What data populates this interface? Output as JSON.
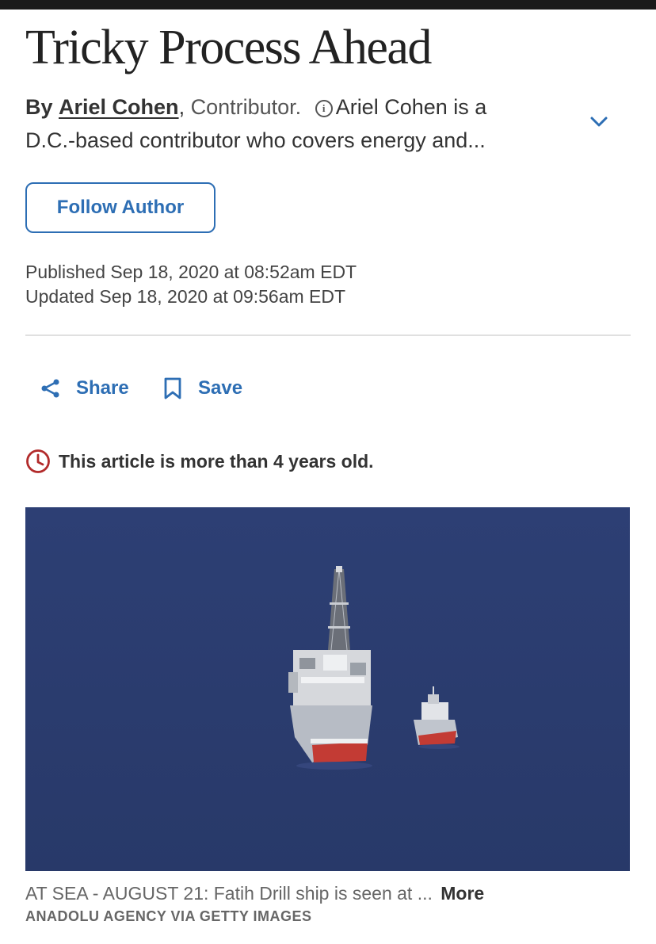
{
  "article": {
    "headline": "Tricky Process Ahead",
    "byline": {
      "by_label": "By",
      "author_name": "Ariel Cohen",
      "comma": ",",
      "role": "Contributor.",
      "bio_preview_line1": "Ariel Cohen is a",
      "bio_preview_line2": "D.C.-based contributor who covers energy and..."
    },
    "follow_button_label": "Follow Author",
    "published": "Published Sep 18, 2020 at 08:52am EDT",
    "updated": "Updated Sep 18, 2020 at 09:56am EDT",
    "actions": {
      "share_label": "Share",
      "save_label": "Save"
    },
    "age_notice": "This article is more than 4 years old.",
    "image": {
      "caption": "AT SEA - AUGUST 21: Fatih Drill ship is seen at ...",
      "more_label": "More",
      "credit": "ANADOLU AGENCY VIA GETTY IMAGES"
    }
  },
  "icons": {
    "info": "info-icon",
    "expand": "chevron-down-icon",
    "share": "share-icon",
    "save": "bookmark-icon",
    "age": "clock-icon"
  },
  "colors": {
    "link_blue": "#2d6eb4",
    "alert_red": "#b22b2b",
    "sea_blue": "#2b3d72"
  }
}
